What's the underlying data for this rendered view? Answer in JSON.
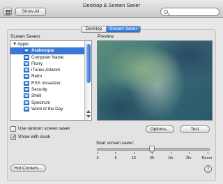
{
  "window": {
    "title": "Desktop & Screen Saver"
  },
  "toolbar": {
    "show_all_label": "Show All",
    "search_placeholder": "",
    "grid_icon": "grid-icon",
    "search_icon": "search-icon"
  },
  "tabs": [
    {
      "label": "Desktop",
      "selected": false
    },
    {
      "label": "Screen Saver",
      "selected": true
    }
  ],
  "savers": {
    "section_label": "Screen Savers",
    "group_label": "Apple",
    "items": [
      {
        "label": "Arabesque",
        "selected": true
      },
      {
        "label": "Computer Name",
        "selected": false
      },
      {
        "label": "Flurry",
        "selected": false
      },
      {
        "label": "iTunes Artwork",
        "selected": false
      },
      {
        "label": "Retro",
        "selected": false
      },
      {
        "label": "RSS Visualizer",
        "selected": false
      },
      {
        "label": "Security",
        "selected": false
      },
      {
        "label": "Shell",
        "selected": false
      },
      {
        "label": "Spectrum",
        "selected": false
      },
      {
        "label": "Word of the Day",
        "selected": false
      }
    ]
  },
  "preview": {
    "label": "Preview"
  },
  "buttons": {
    "options": "Options...",
    "test": "Test",
    "hot_corners": "Hot Corners...",
    "help": "?"
  },
  "options": {
    "random": {
      "label": "Use random screen saver",
      "checked": false
    },
    "clock": {
      "label": "Show with clock",
      "checked": true
    }
  },
  "start": {
    "label": "Start screen saver:",
    "ticks": [
      "3",
      "5",
      "15",
      "30",
      "1hr",
      "2hr",
      "Never"
    ],
    "selected_value": "30"
  },
  "colors": {
    "selection": "#3878d8",
    "accent": "#2f6fd3"
  }
}
